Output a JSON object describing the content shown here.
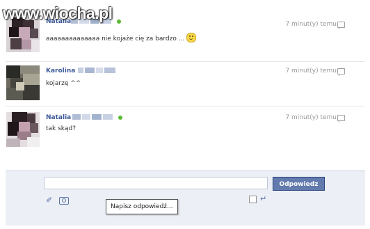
{
  "watermark": "www.wiocha.pl",
  "messages": [
    {
      "sender": "Natalia",
      "text": "aaaaaaaaaaaaaa nie kojaże cię za bardzo ...",
      "time": "7 minut(y) temu"
    },
    {
      "sender": "Karolina",
      "text": "kojarzę ^^",
      "time": "7 minut(y) temu"
    },
    {
      "sender": "Natalia",
      "text": "tak skąd?",
      "time": "7 minut(y) temu"
    }
  ],
  "composer": {
    "input_value": "",
    "reply_button": "Odpowiedz",
    "tooltip": "Napisz odpowiedź..."
  },
  "icons": {
    "smiley": "smiley-emoticon-icon",
    "reply": "reply-icon",
    "attach": "paperclip-icon",
    "camera": "camera-icon",
    "enter": "enter-key-icon"
  },
  "colors": {
    "link": "#3b5998",
    "button": "#627aad",
    "online": "#5cb934",
    "composer_bg": "#eceff5"
  }
}
